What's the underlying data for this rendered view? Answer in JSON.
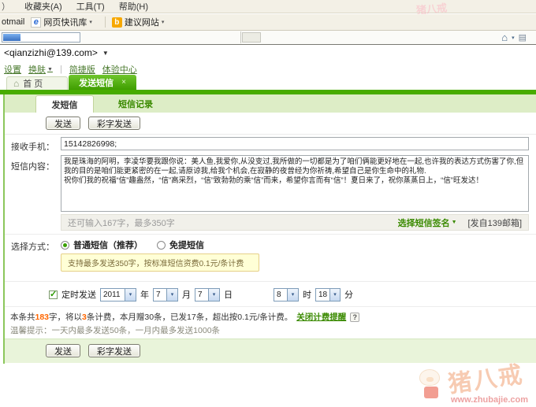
{
  "browser": {
    "menu_prefix": "）",
    "menu": [
      "收藏夹(A)",
      "工具(T)",
      "帮助(H)"
    ],
    "hotmail_label": "otmail",
    "webslice_label": "网页快讯库",
    "suggest_label": "建议网站"
  },
  "icons": {
    "dropdown": "▼",
    "dropdown_small": "▾",
    "check": "✓",
    "close": "×",
    "home": "⌂",
    "help": "?",
    "ie": "e",
    "bing": "b",
    "page": "▤"
  },
  "account": {
    "email": "<qianzizhi@139.com>"
  },
  "nav": {
    "links": [
      "设置",
      "换肤",
      "简捷版",
      "体验中心"
    ],
    "separator": "|"
  },
  "page_tabs": {
    "home": "首 页",
    "active": "发送短信"
  },
  "content_tabs": {
    "compose": "发短信",
    "history": "短信记录"
  },
  "buttons": {
    "send": "发送",
    "color_send": "彩字发送"
  },
  "form": {
    "recipient_label": "接收手机：",
    "recipient_value": "15142826998;",
    "content_label": "短信内容：",
    "message_para1": "我是珠海的阿明，李凌华要我跟你说：美人鱼,我爱你,从没变过,我所做的一切都是为了咱们俩能更好地在一起,也许我的表达方式伤害了你,但我的目的是咱们能更紧密的在一起,请原谅我,给我个机会,在寂静的夜曾经为你祈祷,希望自己是你生命中的礼物.",
    "message_para2": "祝你们我的祝福“信”趣盎然，“信”高采烈，“信”致勃勃的乘“信”而来，希望你言而有“信”！夏日来了，祝你蒸蒸日上，“信”旺发达！",
    "counter": "还可输入167字，最多350字",
    "signature_link": "选择短信签名",
    "from_tag": "[发自139邮箱]",
    "method_label": "选择方式：",
    "method_normal": "普通短信（推荐）",
    "method_free": "免提短信",
    "tip": "支持最多发送350字，按标准短信资费0.1元/条计费",
    "schedule_label": "定时发送",
    "year": "2011",
    "year_unit": "年",
    "month": "7",
    "month_unit": "月",
    "day": "7",
    "day_unit": "日",
    "hour": "8",
    "hour_unit": "时",
    "minute": "18",
    "minute_unit": "分"
  },
  "billing": {
    "segment1": "本条共",
    "chars": "183",
    "segment2": "字，将以",
    "pieces": "3",
    "segment3": "条计费，本月赠30条，已发17条，超出按0.1元/条计费。",
    "reminder_link": "关闭计费提醒",
    "notice": "温馨提示：一天内最多发送50条，一月内最多发送1000条"
  },
  "watermark": {
    "brand": "猪八戒",
    "site": "www.zhubajie.com"
  },
  "colors": {
    "brand_green": "#48ac00",
    "link_green": "#3a8a00",
    "highlight_orange": "#ff6600"
  }
}
